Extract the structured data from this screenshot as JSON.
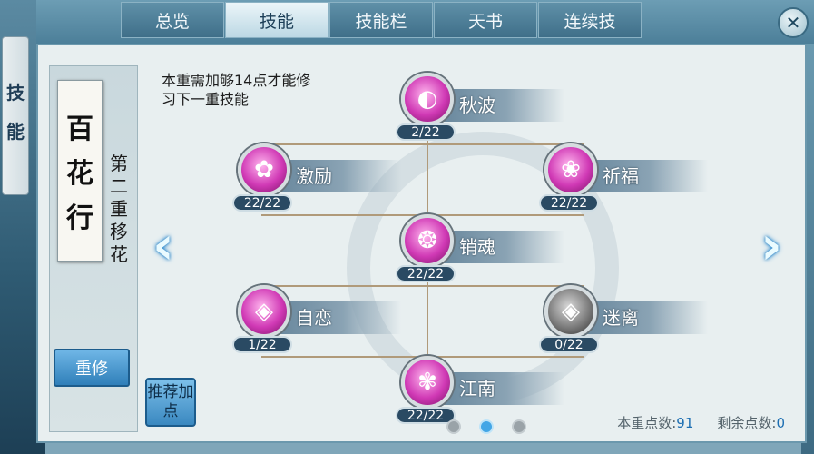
{
  "side_tab": {
    "chars": [
      "技",
      "能"
    ]
  },
  "tabs": [
    {
      "label": "总览",
      "active": false
    },
    {
      "label": "技能",
      "active": true
    },
    {
      "label": "技能栏",
      "active": false
    },
    {
      "label": "天书",
      "active": false
    },
    {
      "label": "连续技",
      "active": false
    }
  ],
  "close_icon": "close-icon",
  "school": {
    "chars": [
      "百",
      "花",
      "行"
    ]
  },
  "stage_title": {
    "chars": [
      "第",
      "二",
      "重",
      "移",
      "花"
    ]
  },
  "notice": "本重需加够14点才能修习下一重技能",
  "buttons": {
    "redo": "重修",
    "recommend": "推荐加点"
  },
  "skills": [
    {
      "name": "秋波",
      "level": "2/22",
      "icon": "pink",
      "glyph": "◐"
    },
    {
      "name": "激励",
      "level": "22/22",
      "icon": "pink",
      "glyph": "✿"
    },
    {
      "name": "祈福",
      "level": "22/22",
      "icon": "pink",
      "glyph": "❀"
    },
    {
      "name": "销魂",
      "level": "22/22",
      "icon": "pink",
      "glyph": "❂"
    },
    {
      "name": "自恋",
      "level": "1/22",
      "icon": "pink",
      "glyph": "◈"
    },
    {
      "name": "迷离",
      "level": "0/22",
      "icon": "gray",
      "glyph": "◈"
    },
    {
      "name": "江南",
      "level": "22/22",
      "icon": "pink",
      "glyph": "✾"
    }
  ],
  "page_dots": {
    "count": 3,
    "active_index": 1
  },
  "points": {
    "stage_label": "本重点数:",
    "stage_value": "91",
    "remain_label": "剩余点数:",
    "remain_value": "0"
  },
  "colors": {
    "accent_blue": "#43a6e6",
    "skill_pink": "#d039b5",
    "panel_bg": "#e8eff0"
  }
}
